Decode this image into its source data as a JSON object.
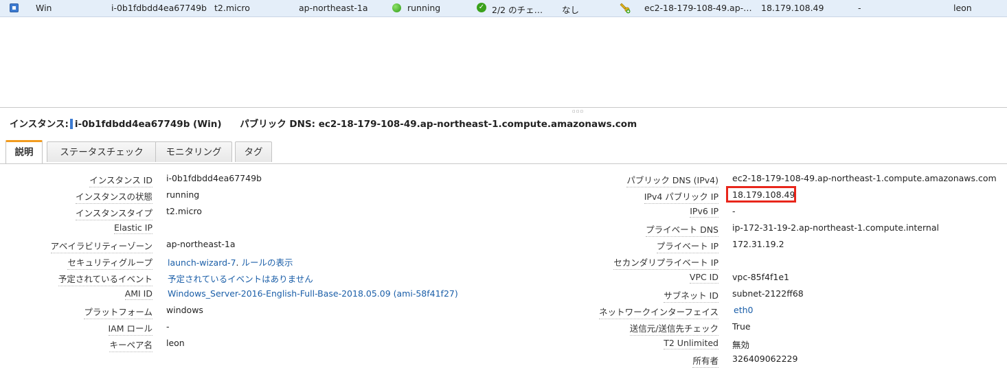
{
  "instance_row": {
    "name": "Win",
    "instance_id": "i-0b1fdbdd4ea67749b",
    "instance_type": "t2.micro",
    "az": "ap-northeast-1a",
    "state": "running",
    "status_check": "2/2 のチェ…",
    "alarm": "なし",
    "public_dns": "ec2-18-179-108-49.ap-…",
    "public_ip": "18.179.108.49",
    "ipv6": "-",
    "key_name": "leon"
  },
  "summary": {
    "instance_label": "インスタンス:",
    "instance_value": "i-0b1fdbdd4ea67749b (Win)",
    "dns_label": "パブリック DNS:",
    "dns_value": "ec2-18-179-108-49.ap-northeast-1.compute.amazonaws.com"
  },
  "tabs": [
    "説明",
    "ステータスチェック",
    "モニタリング",
    "タグ"
  ],
  "details_left": [
    {
      "label": "インスタンス ID",
      "value": "i-0b1fdbdd4ea67749b"
    },
    {
      "label": "インスタンスの状態",
      "value": "running"
    },
    {
      "label": "インスタンスタイプ",
      "value": "t2.micro"
    },
    {
      "label": "Elastic IP",
      "value": ""
    },
    {
      "label": "アベイラビリティーゾーン",
      "value": "ap-northeast-1a"
    },
    {
      "label": "セキュリティグループ",
      "value": "launch-wizard-7",
      "value_suffix": ". ",
      "value_link2": "ルールの表示"
    },
    {
      "label": "予定されているイベント",
      "value": "予定されているイベントはありません"
    },
    {
      "label": "AMI ID",
      "value": "Windows_Server-2016-English-Full-Base-2018.05.09 (ami-58f41f27)"
    },
    {
      "label": "プラットフォーム",
      "value": "windows"
    },
    {
      "label": "IAM ロール",
      "value": "-"
    },
    {
      "label": "キーペア名",
      "value": "leon"
    }
  ],
  "details_right": [
    {
      "label": "パブリック DNS (IPv4)",
      "value": "ec2-18-179-108-49.ap-northeast-1.compute.amazonaws.com"
    },
    {
      "label": "IPv4 パブリック IP",
      "value": "18.179.108.49"
    },
    {
      "label": "IPv6 IP",
      "value": "-"
    },
    {
      "label": "プライベート DNS",
      "value": "ip-172-31-19-2.ap-northeast-1.compute.internal"
    },
    {
      "label": "プライベート IP",
      "value": "172.31.19.2"
    },
    {
      "label": "セカンダリプライベート IP",
      "value": ""
    },
    {
      "label": "VPC ID",
      "value": "vpc-85f4f1e1"
    },
    {
      "label": "サブネット ID",
      "value": "subnet-2122ff68"
    },
    {
      "label": "ネットワークインターフェイス",
      "value": "eth0"
    },
    {
      "label": "送信元/送信先チェック",
      "value": "True"
    },
    {
      "label": "T2 Unlimited",
      "value": "無効"
    },
    {
      "label": "所有者",
      "value": "326409062229"
    }
  ],
  "colors": {
    "accent": "#3d7bd1",
    "tab_active": "#f29c1f",
    "highlight": "#e8261b",
    "link": "#1a5ea8"
  },
  "icons": [
    "checkbox-checked-icon",
    "running-status-icon",
    "check-passed-icon",
    "key-add-icon"
  ]
}
